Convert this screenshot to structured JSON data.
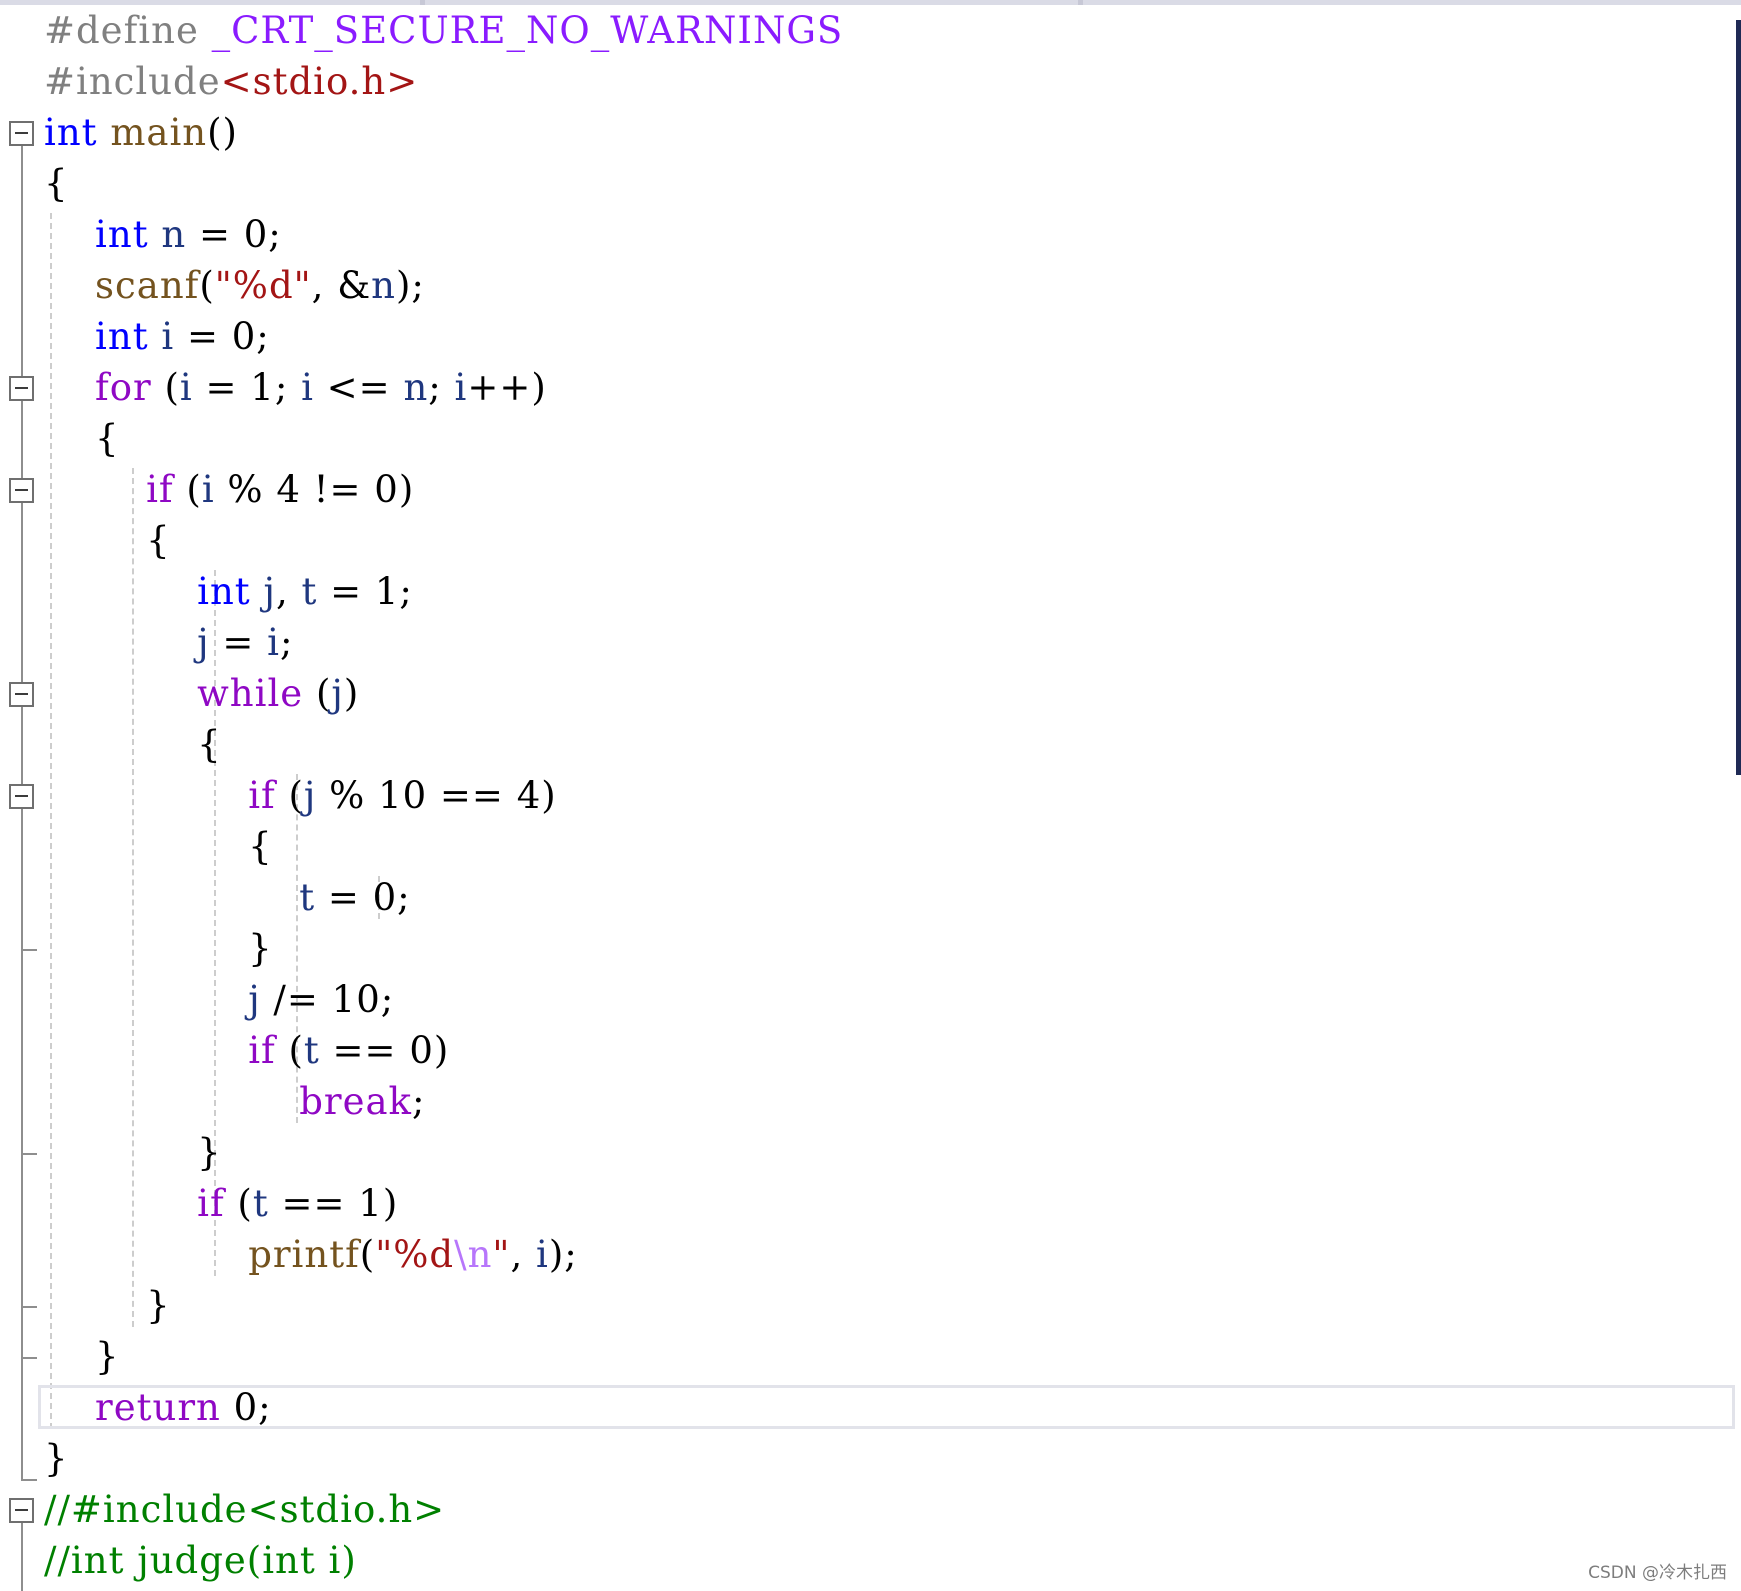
{
  "colors": {
    "keyword_type": "#0000ff",
    "keyword_control": "#8f08c4",
    "identifier_local": "#1f377f",
    "function_name": "#74531f",
    "string": "#a31515",
    "escape": "#b776fb",
    "preprocessor": "#808080",
    "macro": "#8a1bff",
    "comment": "#008000",
    "plain": "#000000"
  },
  "code": {
    "lines": [
      [
        {
          "t": "#define ",
          "c": "preprocessor"
        },
        {
          "t": "_CRT_SECURE_NO_WARNINGS",
          "c": "macro"
        }
      ],
      [
        {
          "t": "#include",
          "c": "preprocessor"
        },
        {
          "t": "<stdio.h>",
          "c": "string"
        }
      ],
      [
        {
          "t": "int",
          "c": "keyword_type"
        },
        {
          "t": " ",
          "c": "plain"
        },
        {
          "t": "main",
          "c": "function_name"
        },
        {
          "t": "()",
          "c": "plain"
        }
      ],
      [
        {
          "t": "{",
          "c": "plain"
        }
      ],
      [
        {
          "t": "    ",
          "c": "plain"
        },
        {
          "t": "int",
          "c": "keyword_type"
        },
        {
          "t": " ",
          "c": "plain"
        },
        {
          "t": "n",
          "c": "identifier_local"
        },
        {
          "t": " = 0;",
          "c": "plain"
        }
      ],
      [
        {
          "t": "    ",
          "c": "plain"
        },
        {
          "t": "scanf",
          "c": "function_name"
        },
        {
          "t": "(",
          "c": "plain"
        },
        {
          "t": "\"%d\"",
          "c": "string"
        },
        {
          "t": ", &",
          "c": "plain"
        },
        {
          "t": "n",
          "c": "identifier_local"
        },
        {
          "t": ");",
          "c": "plain"
        }
      ],
      [
        {
          "t": "    ",
          "c": "plain"
        },
        {
          "t": "int",
          "c": "keyword_type"
        },
        {
          "t": " ",
          "c": "plain"
        },
        {
          "t": "i",
          "c": "identifier_local"
        },
        {
          "t": " = 0;",
          "c": "plain"
        }
      ],
      [
        {
          "t": "    ",
          "c": "plain"
        },
        {
          "t": "for",
          "c": "keyword_control"
        },
        {
          "t": " (",
          "c": "plain"
        },
        {
          "t": "i",
          "c": "identifier_local"
        },
        {
          "t": " = 1; ",
          "c": "plain"
        },
        {
          "t": "i",
          "c": "identifier_local"
        },
        {
          "t": " <= ",
          "c": "plain"
        },
        {
          "t": "n",
          "c": "identifier_local"
        },
        {
          "t": "; ",
          "c": "plain"
        },
        {
          "t": "i",
          "c": "identifier_local"
        },
        {
          "t": "++)",
          "c": "plain"
        }
      ],
      [
        {
          "t": "    {",
          "c": "plain"
        }
      ],
      [
        {
          "t": "        ",
          "c": "plain"
        },
        {
          "t": "if",
          "c": "keyword_control"
        },
        {
          "t": " (",
          "c": "plain"
        },
        {
          "t": "i",
          "c": "identifier_local"
        },
        {
          "t": " % 4 != 0)",
          "c": "plain"
        }
      ],
      [
        {
          "t": "        {",
          "c": "plain"
        }
      ],
      [
        {
          "t": "            ",
          "c": "plain"
        },
        {
          "t": "int",
          "c": "keyword_type"
        },
        {
          "t": " ",
          "c": "plain"
        },
        {
          "t": "j",
          "c": "identifier_local"
        },
        {
          "t": ", ",
          "c": "plain"
        },
        {
          "t": "t",
          "c": "identifier_local"
        },
        {
          "t": " = 1;",
          "c": "plain"
        }
      ],
      [
        {
          "t": "            ",
          "c": "plain"
        },
        {
          "t": "j",
          "c": "identifier_local"
        },
        {
          "t": " = ",
          "c": "plain"
        },
        {
          "t": "i",
          "c": "identifier_local"
        },
        {
          "t": ";",
          "c": "plain"
        }
      ],
      [
        {
          "t": "            ",
          "c": "plain"
        },
        {
          "t": "while",
          "c": "keyword_control"
        },
        {
          "t": " (",
          "c": "plain"
        },
        {
          "t": "j",
          "c": "identifier_local"
        },
        {
          "t": ")",
          "c": "plain"
        }
      ],
      [
        {
          "t": "            {",
          "c": "plain"
        }
      ],
      [
        {
          "t": "                ",
          "c": "plain"
        },
        {
          "t": "if",
          "c": "keyword_control"
        },
        {
          "t": " (",
          "c": "plain"
        },
        {
          "t": "j",
          "c": "identifier_local"
        },
        {
          "t": " % 10 == 4)",
          "c": "plain"
        }
      ],
      [
        {
          "t": "                {",
          "c": "plain"
        }
      ],
      [
        {
          "t": "                    ",
          "c": "plain"
        },
        {
          "t": "t",
          "c": "identifier_local"
        },
        {
          "t": " = 0;",
          "c": "plain"
        }
      ],
      [
        {
          "t": "                }",
          "c": "plain"
        }
      ],
      [
        {
          "t": "                ",
          "c": "plain"
        },
        {
          "t": "j",
          "c": "identifier_local"
        },
        {
          "t": " /= 10;",
          "c": "plain"
        }
      ],
      [
        {
          "t": "                ",
          "c": "plain"
        },
        {
          "t": "if",
          "c": "keyword_control"
        },
        {
          "t": " (",
          "c": "plain"
        },
        {
          "t": "t",
          "c": "identifier_local"
        },
        {
          "t": " == 0)",
          "c": "plain"
        }
      ],
      [
        {
          "t": "                    ",
          "c": "plain"
        },
        {
          "t": "break",
          "c": "keyword_control"
        },
        {
          "t": ";",
          "c": "plain"
        }
      ],
      [
        {
          "t": "            }",
          "c": "plain"
        }
      ],
      [
        {
          "t": "            ",
          "c": "plain"
        },
        {
          "t": "if",
          "c": "keyword_control"
        },
        {
          "t": " (",
          "c": "plain"
        },
        {
          "t": "t",
          "c": "identifier_local"
        },
        {
          "t": " == 1)",
          "c": "plain"
        }
      ],
      [
        {
          "t": "                ",
          "c": "plain"
        },
        {
          "t": "printf",
          "c": "function_name"
        },
        {
          "t": "(",
          "c": "plain"
        },
        {
          "t": "\"%d",
          "c": "string"
        },
        {
          "t": "\\n",
          "c": "escape"
        },
        {
          "t": "\"",
          "c": "string"
        },
        {
          "t": ", ",
          "c": "plain"
        },
        {
          "t": "i",
          "c": "identifier_local"
        },
        {
          "t": ");",
          "c": "plain"
        }
      ],
      [
        {
          "t": "        }",
          "c": "plain"
        }
      ],
      [
        {
          "t": "    }",
          "c": "plain"
        }
      ],
      [
        {
          "t": "    ",
          "c": "plain"
        },
        {
          "t": "return",
          "c": "keyword_control"
        },
        {
          "t": " 0;",
          "c": "plain"
        }
      ],
      [
        {
          "t": "}",
          "c": "plain"
        }
      ],
      [
        {
          "t": "//#include<stdio.h>",
          "c": "comment"
        }
      ],
      [
        {
          "t": "//int judge(int i)",
          "c": "comment"
        }
      ]
    ]
  },
  "watermark": "CSDN @冷木扎西"
}
